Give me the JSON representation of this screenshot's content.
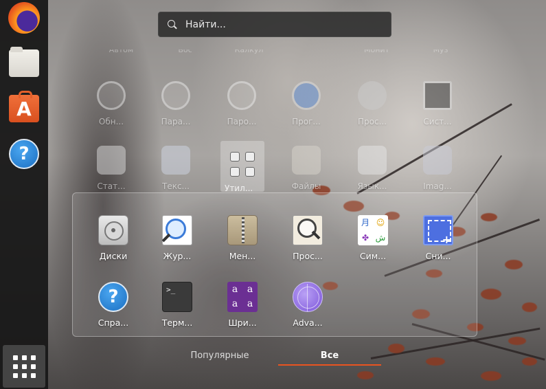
{
  "search": {
    "placeholder": "Найти..."
  },
  "dock": {
    "items": [
      {
        "name": "Firefox",
        "icon": "firefox-icon"
      },
      {
        "name": "Files",
        "icon": "files-icon"
      },
      {
        "name": "Ubuntu Software",
        "icon": "software-icon"
      },
      {
        "name": "Help",
        "icon": "help-icon",
        "glyph": "?"
      }
    ],
    "show_apps_icon": "grid-icon"
  },
  "background_apps": {
    "top_row_labels": [
      "Автом",
      "Вос",
      "Калкул",
      "",
      "Монит",
      "Муз"
    ],
    "row1": [
      "Обн...",
      "Пара...",
      "Паро...",
      "Прог...",
      "Прос...",
      "Сист..."
    ],
    "row2": [
      "Стат...",
      "Текс...",
      "Утил...",
      "Файлы",
      "Язык...",
      "Imag..."
    ]
  },
  "folder": {
    "title": "Утил...",
    "apps": [
      {
        "label": "Диски",
        "icon": "disks-icon"
      },
      {
        "label": "Жур...",
        "icon": "logs-icon"
      },
      {
        "label": "Мен...",
        "icon": "archive-manager-icon"
      },
      {
        "label": "Прос...",
        "icon": "disk-usage-icon"
      },
      {
        "label": "Сим...",
        "icon": "characters-icon",
        "glyphs": [
          "月",
          "☺",
          "✤",
          "ش"
        ]
      },
      {
        "label": "Сни...",
        "icon": "screenshot-icon"
      },
      {
        "label": "Спра...",
        "icon": "help-icon",
        "glyph": "?"
      },
      {
        "label": "Терм...",
        "icon": "terminal-icon",
        "glyph": ">_"
      },
      {
        "label": "Шри...",
        "icon": "fonts-icon",
        "glyphs": [
          "a",
          "a",
          "a",
          "a"
        ]
      },
      {
        "label": "Adva...",
        "icon": "advanced-network-icon"
      }
    ]
  },
  "tabs": {
    "popular": "Популярные",
    "all": "Все",
    "active": "all"
  },
  "colors": {
    "accent": "#e95420",
    "dock_bg": "#181818"
  }
}
